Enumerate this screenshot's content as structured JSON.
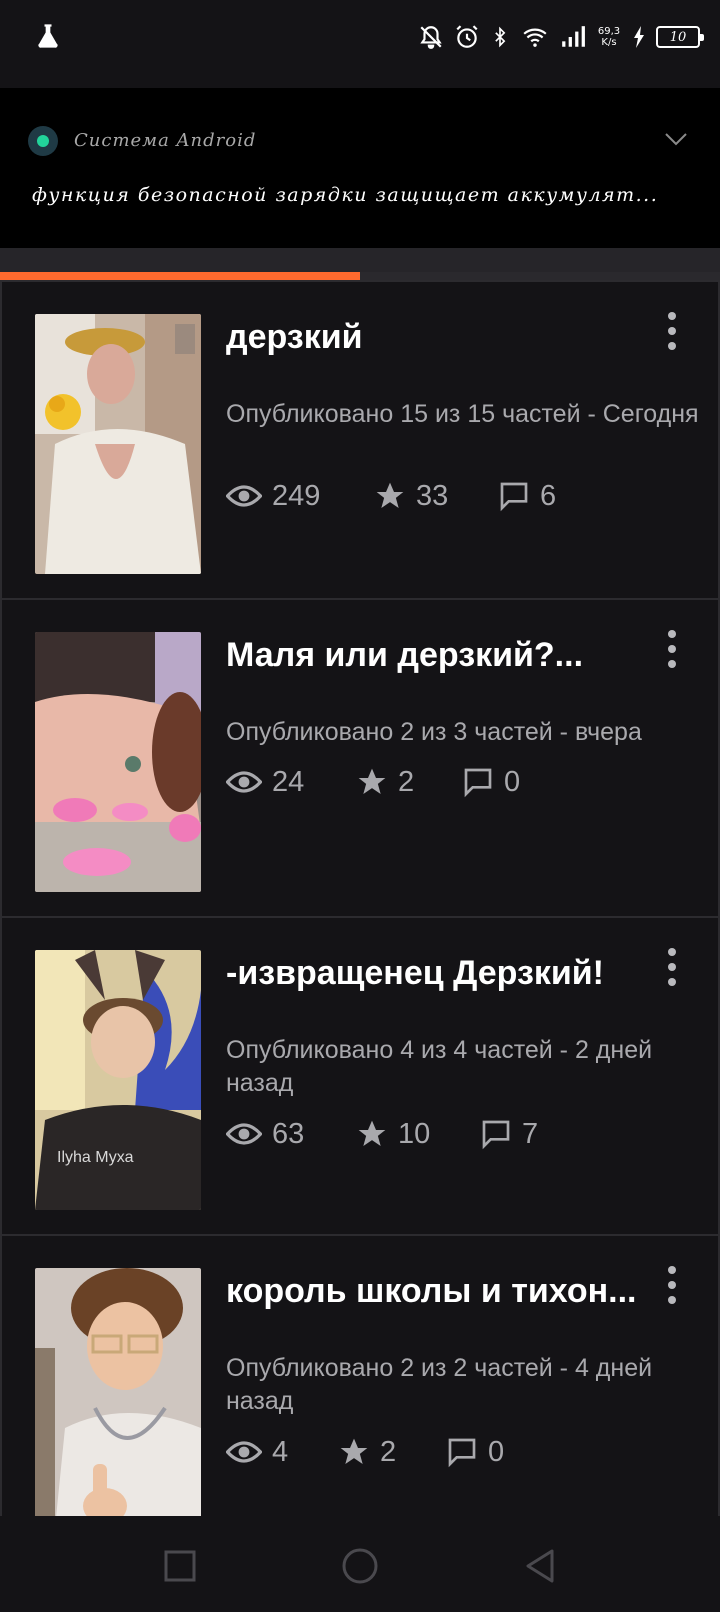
{
  "status_bar": {
    "speed_value": "69,3",
    "speed_unit": "K/s",
    "battery_level": "10",
    "icons": [
      "flask-icon",
      "bell-off-icon",
      "alarm-icon",
      "bluetooth-icon",
      "wifi-icon",
      "signal-icon",
      "charging-icon",
      "battery-icon"
    ]
  },
  "notification": {
    "app_name": "Система Android",
    "message": "функция безопасной зарядки защищает аккумулят..."
  },
  "progress": {
    "fraction": 0.5,
    "color": "#ff6a2e"
  },
  "stories": [
    {
      "title": "дерзкий",
      "meta": "Опубликовано 15 из 15 частей - Сегодня",
      "views": "249",
      "votes": "33",
      "comments": "6"
    },
    {
      "title": "Маля или дерзкий?...",
      "meta": "Опубликовано 2 из 3 частей - вчера",
      "views": "24",
      "votes": "2",
      "comments": "0"
    },
    {
      "title": "-извращенец Дерзкий!",
      "meta": "Опубликовано 4 из 4 частей - 2 дней назад",
      "views": "63",
      "votes": "10",
      "comments": "7"
    },
    {
      "title": "король школы и тихон...",
      "meta": "Опубликовано 2 из 2 частей - 4 дней назад",
      "views": "4",
      "votes": "2",
      "comments": "0"
    }
  ],
  "cover_text": {
    "shirt_print": "Ilyha Муха"
  },
  "nav": [
    "recent-apps-icon",
    "home-icon",
    "back-icon"
  ]
}
